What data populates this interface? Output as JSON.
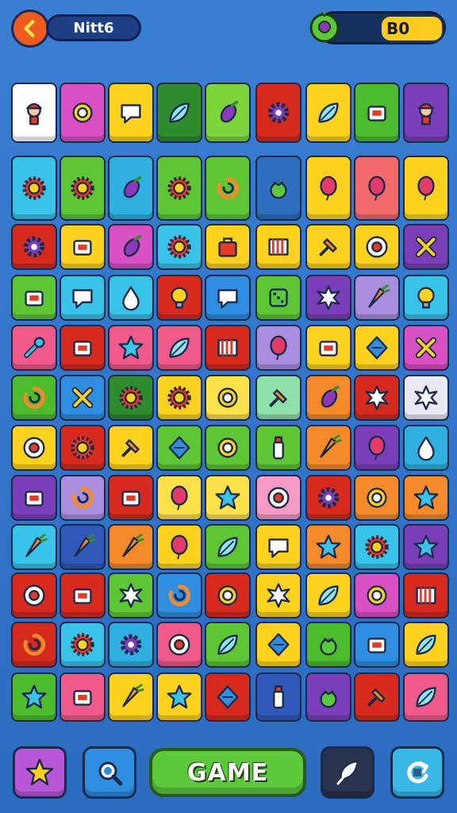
{
  "header": {
    "back_icon": "chevron-left-icon",
    "player_name": "Nitt6",
    "coin_label": "B0",
    "coin_icon": "green-orb-icon"
  },
  "colors": {
    "background": "#2f72c8",
    "game_button": "#5cc93a"
  },
  "board": {
    "rows": [
      [
        [
          "#ffffff",
          "figure"
        ],
        [
          "#d94fc4",
          "ring"
        ],
        [
          "#ffd21f",
          "bubble"
        ],
        [
          "#2f8c2c",
          "leaf"
        ],
        [
          "#7bd43a",
          "eggplant"
        ],
        [
          "#d62a1f",
          "cog"
        ],
        [
          "#ffd21f",
          "leaf"
        ],
        [
          "#4cbb2e",
          "box"
        ],
        [
          "#7a3fb8",
          "figure"
        ]
      ],
      [
        [
          "#39c3e8",
          "sun"
        ],
        [
          "#5ec634",
          "sun"
        ],
        [
          "#2fb0e0",
          "eggplant"
        ],
        [
          "#5ec634",
          "sun"
        ],
        [
          "#5ec634",
          "swirl"
        ],
        [
          "#2f6fbf",
          "berry"
        ],
        [
          "#ffd21f",
          "balloon"
        ],
        [
          "#f26a6a",
          "balloon"
        ],
        [
          "#ffd21f",
          "balloon"
        ]
      ],
      [
        [
          "#d62a1f",
          "cog"
        ],
        [
          "#ffd21f",
          "box"
        ],
        [
          "#d94fc4",
          "eggplant"
        ],
        [
          "#39c3e8",
          "sun"
        ],
        [
          "#ffd21f",
          "bag"
        ],
        [
          "#ffd21f",
          "stripes"
        ],
        [
          "#ffd21f",
          "pin"
        ],
        [
          "#ffd21f",
          "target"
        ],
        [
          "#7a3fb8",
          "cross"
        ]
      ],
      [
        [
          "#5ec634",
          "box"
        ],
        [
          "#39c3e8",
          "bubble"
        ],
        [
          "#39c3e8",
          "drop"
        ],
        [
          "#d62a1f",
          "bulb"
        ],
        [
          "#2f8ee0",
          "bubble"
        ],
        [
          "#5ec634",
          "dice"
        ],
        [
          "#7a3fb8",
          "burst"
        ],
        [
          "#a98ee0",
          "carrot"
        ],
        [
          "#39c3e8",
          "bulb"
        ]
      ],
      [
        [
          "#f05a8a",
          "wrench"
        ],
        [
          "#d62a1f",
          "box"
        ],
        [
          "#f05a8a",
          "star"
        ],
        [
          "#f05a8a",
          "leaf"
        ],
        [
          "#d62a1f",
          "stripes"
        ],
        [
          "#a98ee0",
          "balloon"
        ],
        [
          "#ffd21f",
          "box"
        ],
        [
          "#ffd21f",
          "diamond"
        ],
        [
          "#d94fc4",
          "cross"
        ]
      ],
      [
        [
          "#4cbb2e",
          "swirl"
        ],
        [
          "#2f8ee0",
          "cross"
        ],
        [
          "#2f8c2c",
          "sun"
        ],
        [
          "#ffd21f",
          "sun"
        ],
        [
          "#ffe14a",
          "ring"
        ],
        [
          "#8ee0a8",
          "pin"
        ],
        [
          "#f58a2a",
          "eggplant"
        ],
        [
          "#d62a1f",
          "burst"
        ],
        [
          "#eaeaf5",
          "burst"
        ]
      ],
      [
        [
          "#ffd21f",
          "target"
        ],
        [
          "#d62a1f",
          "sun"
        ],
        [
          "#ffd21f",
          "pin"
        ],
        [
          "#5ec634",
          "diamond"
        ],
        [
          "#5ec634",
          "ring"
        ],
        [
          "#5ec634",
          "bottle"
        ],
        [
          "#f58a2a",
          "carrot"
        ],
        [
          "#7a3fb8",
          "balloon"
        ],
        [
          "#2fb0e0",
          "drop"
        ]
      ],
      [
        [
          "#7a3fb8",
          "box"
        ],
        [
          "#a98ee0",
          "swirl"
        ],
        [
          "#d62a1f",
          "box"
        ],
        [
          "#ffe14a",
          "balloon"
        ],
        [
          "#ffe14a",
          "star"
        ],
        [
          "#f59ac4",
          "target"
        ],
        [
          "#d62a1f",
          "cog"
        ],
        [
          "#f58a2a",
          "ring"
        ],
        [
          "#f58a2a",
          "star"
        ]
      ],
      [
        [
          "#39c3e8",
          "carrot"
        ],
        [
          "#2f58b8",
          "carrot"
        ],
        [
          "#f58a2a",
          "carrot"
        ],
        [
          "#ffd21f",
          "balloon"
        ],
        [
          "#5ec634",
          "leaf"
        ],
        [
          "#ffd21f",
          "bubble"
        ],
        [
          "#f58a2a",
          "star"
        ],
        [
          "#39c3e8",
          "sun"
        ],
        [
          "#7a3fb8",
          "star"
        ]
      ],
      [
        [
          "#d62a1f",
          "target"
        ],
        [
          "#d62a1f",
          "box"
        ],
        [
          "#5ec634",
          "burst"
        ],
        [
          "#2f8ee0",
          "swirl"
        ],
        [
          "#d62a1f",
          "ring"
        ],
        [
          "#ffd21f",
          "burst"
        ],
        [
          "#ffd21f",
          "leaf"
        ],
        [
          "#d94fc4",
          "ring"
        ],
        [
          "#d62a1f",
          "stripes"
        ]
      ],
      [
        [
          "#d62a1f",
          "swirl"
        ],
        [
          "#39c3e8",
          "sun"
        ],
        [
          "#2fb0e0",
          "cog"
        ],
        [
          "#f05a8a",
          "target"
        ],
        [
          "#5ec634",
          "leaf"
        ],
        [
          "#ffd21f",
          "diamond"
        ],
        [
          "#4cbb2e",
          "berry"
        ],
        [
          "#2f8ee0",
          "box"
        ],
        [
          "#ffd21f",
          "leaf"
        ]
      ],
      [
        [
          "#4cbb2e",
          "star"
        ],
        [
          "#f05a8a",
          "box"
        ],
        [
          "#ffd21f",
          "carrot"
        ],
        [
          "#ffd21f",
          "star"
        ],
        [
          "#d62a1f",
          "diamond"
        ],
        [
          "#2f58b8",
          "bottle"
        ],
        [
          "#7a3fb8",
          "berry"
        ],
        [
          "#d62a1f",
          "pin"
        ],
        [
          "#f05a8a",
          "leaf"
        ]
      ]
    ]
  },
  "footer": {
    "left_icon": "star-icon",
    "search_icon": "search-icon",
    "game_label": "GAME",
    "feather_icon": "feather-icon",
    "refresh_icon": "refresh-icon"
  }
}
